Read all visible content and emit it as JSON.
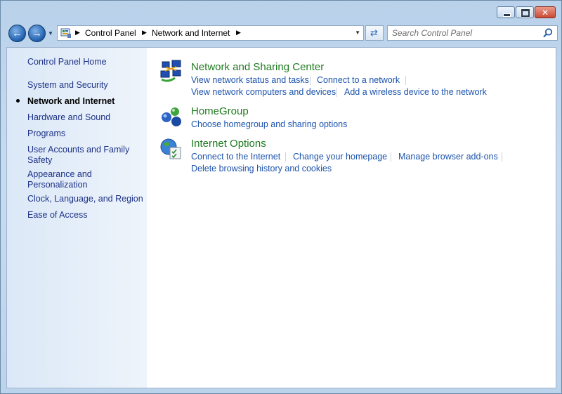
{
  "window": {
    "caption_buttons": {
      "minimize": "minimize",
      "maximize": "maximize",
      "close": "✕"
    }
  },
  "nav": {
    "back_icon": "back-arrow-icon",
    "forward_icon": "forward-arrow-icon"
  },
  "address_bar": {
    "breadcrumbs": [
      "Control Panel",
      "Network and Internet"
    ]
  },
  "search": {
    "placeholder": "Search Control Panel"
  },
  "sidebar": {
    "items": [
      {
        "label": "Control Panel Home"
      },
      {
        "label": "System and Security"
      },
      {
        "label": "Network and Internet",
        "current": true
      },
      {
        "label": "Hardware and Sound"
      },
      {
        "label": "Programs"
      },
      {
        "label": "User Accounts and Family Safety",
        "line1": "User Accounts and Family",
        "line2": "Safety"
      },
      {
        "label": "Appearance and Personalization",
        "line1": "Appearance and",
        "line2": "Personalization"
      },
      {
        "label": "Clock, Language, and Region"
      },
      {
        "label": "Ease of Access"
      }
    ]
  },
  "categories": [
    {
      "title": "Network and Sharing Center",
      "icon": "network-sharing-center-icon",
      "links": [
        "View network status and tasks",
        "Connect to a network",
        "View network computers and devices",
        "Add a wireless device to the network"
      ]
    },
    {
      "title": "HomeGroup",
      "icon": "homegroup-icon",
      "links": [
        "Choose homegroup and sharing options"
      ]
    },
    {
      "title": "Internet Options",
      "icon": "internet-options-icon",
      "links": [
        "Connect to the Internet",
        "Change your homepage",
        "Manage browser add-ons",
        "Delete browsing history and cookies"
      ]
    }
  ],
  "colors": {
    "link": "#1c53ad",
    "category_title": "#1f7a1f",
    "sidebar_link": "#1e3287"
  }
}
